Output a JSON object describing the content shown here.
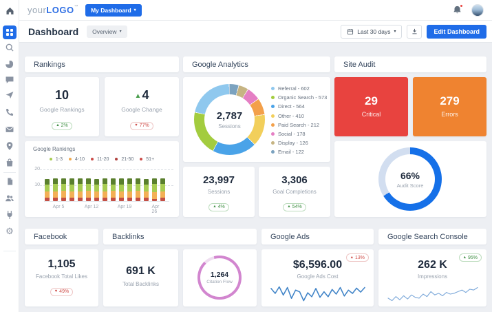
{
  "colors": {
    "accent_blue": "#1f6ce8",
    "critical_red": "#e8433f",
    "errors_orange": "#ef8330",
    "gauge_blue": "#1570e8",
    "gauge_track": "#d2def0",
    "citation_pink": "#d286cf",
    "citation_track": "#efddf0",
    "badge_green": "#3f8f43",
    "badge_red": "#cf4a46"
  },
  "topbar": {
    "logo_prefix": "your",
    "logo_main": "LOGO",
    "logo_tm": "™",
    "menu_label": "My Dashboard",
    "menu_caret": "▾"
  },
  "page_header": {
    "title": "Dashboard",
    "view_label": "Overview",
    "view_caret": "▾",
    "date_label": "Last 30 days",
    "date_caret": "▾",
    "edit_label": "Edit Dashboard"
  },
  "sidebar": {
    "icons": [
      "home",
      "dashboard",
      "search",
      "pie-chart",
      "chat",
      "send",
      "phone",
      "mail",
      "location",
      "shopping-bag",
      "document",
      "users",
      "plug",
      "settings"
    ]
  },
  "rankings": {
    "title": "Rankings",
    "stats": [
      {
        "value": "10",
        "label": "Google Rankings",
        "badge": {
          "dir": "up",
          "text": "2%",
          "tone": "green"
        }
      },
      {
        "arrow": "▲",
        "value": "4",
        "label": "Google Change",
        "badge": {
          "dir": "down",
          "text": "77%",
          "tone": "red"
        }
      }
    ],
    "chart_title": "Google Rankings",
    "yticks": [
      "20",
      "10"
    ]
  },
  "analytics": {
    "title": "Google Analytics",
    "stats": [
      {
        "value": "23,997",
        "label": "Sessions",
        "badge": {
          "dir": "up",
          "text": "4%",
          "tone": "green"
        }
      },
      {
        "value": "3,306",
        "label": "Goal Completions",
        "badge": {
          "dir": "up",
          "text": "54%",
          "tone": "green"
        }
      }
    ]
  },
  "site_audit": {
    "title": "Site Audit",
    "tiles": [
      {
        "value": "29",
        "label": "Critical"
      },
      {
        "value": "279",
        "label": "Errors"
      }
    ],
    "gauge_value": "66%",
    "gauge_label": "Audit Score"
  },
  "facebook": {
    "title": "Facebook",
    "stat": {
      "value": "1,105",
      "label": "Facebook Total Likes",
      "badge": {
        "dir": "down",
        "text": "49%",
        "tone": "red"
      }
    }
  },
  "backlinks": {
    "title": "Backlinks",
    "stat": {
      "value": "691 K",
      "label": "Total Backlinks"
    },
    "citation": {
      "value": "1,264",
      "label": "Citation Flow"
    }
  },
  "google_ads": {
    "title": "Google Ads",
    "stat": {
      "value": "$6,596.00",
      "label": "Google Ads Cost",
      "badge": {
        "dir": "up",
        "text": "13%",
        "tone": "red"
      }
    }
  },
  "search_console": {
    "title": "Google Search Console",
    "stat": {
      "value": "262 K",
      "label": "Impressions",
      "badge": {
        "dir": "up",
        "text": "95%",
        "tone": "green"
      }
    }
  },
  "chart_data": [
    {
      "type": "donut",
      "title": "Google Analytics Sessions",
      "total": "2,787",
      "center_label": "Sessions",
      "segments": [
        {
          "label": "Referral",
          "value": 602,
          "color": "#8fc8ee"
        },
        {
          "label": "Organic Search",
          "value": 573,
          "color": "#a3cc3f"
        },
        {
          "label": "Direct",
          "value": 564,
          "color": "#4aa3e8"
        },
        {
          "label": "Other",
          "value": 410,
          "color": "#f2cf5b"
        },
        {
          "label": "Paid Search",
          "value": 212,
          "color": "#f3a04a"
        },
        {
          "label": "Social",
          "value": 178,
          "color": "#e57fc4"
        },
        {
          "label": "Display",
          "value": 126,
          "color": "#c6b483"
        },
        {
          "label": "Email",
          "value": 122,
          "color": "#7ba2bf"
        }
      ]
    },
    {
      "type": "bar",
      "stacked": true,
      "title": "Google Rankings",
      "categories": [
        "Apr 5",
        "Apr 12",
        "Apr 19",
        "Apr 26"
      ],
      "ylim": [
        0,
        22
      ],
      "y_ticks": [
        10,
        20
      ],
      "legend": [
        {
          "label": "1-3",
          "color": "#a8cc52"
        },
        {
          "label": "4-10",
          "color": "#f0a94e"
        },
        {
          "label": "11-20",
          "color": "#cb4b47"
        },
        {
          "label": "21-50",
          "color": "#b0413e"
        },
        {
          "label": "51+",
          "color": "#cb4b47"
        }
      ],
      "series": [
        {
          "name": "red",
          "color": "#c34f45",
          "values": [
            2,
            2,
            2,
            2,
            2,
            2,
            2,
            2,
            2,
            2,
            2,
            2,
            2,
            1.5,
            2
          ]
        },
        {
          "name": "orange",
          "color": "#f3b056",
          "values": [
            4,
            4,
            4.5,
            4,
            4,
            4.5,
            4,
            4,
            4.5,
            4,
            4,
            4.5,
            4,
            4,
            4
          ]
        },
        {
          "name": "light-green",
          "color": "#a8cc52",
          "values": [
            4,
            4.5,
            4,
            4,
            4.5,
            4,
            4,
            4.5,
            3.5,
            4,
            4.5,
            4,
            4,
            5,
            4.5
          ]
        },
        {
          "name": "dark-green",
          "color": "#5a7f2d",
          "values": [
            3.5,
            3.5,
            3.5,
            4,
            3.5,
            3.5,
            3.5,
            3.5,
            4,
            4,
            3.5,
            3.5,
            3.5,
            3.5,
            3.5
          ]
        }
      ]
    },
    {
      "type": "gauge",
      "value": 66,
      "label": "Audit Score",
      "color": "#1570e8",
      "track": "#d2def0"
    },
    {
      "type": "ring",
      "value": 1264,
      "label": "Citation Flow",
      "percent": 92,
      "color": "#d286cf",
      "track": "#efddf0"
    },
    {
      "type": "line",
      "name": "Google Ads Cost",
      "color": "#4285c8",
      "values": [
        55,
        40,
        60,
        35,
        58,
        25,
        50,
        45,
        18,
        42,
        30,
        55,
        28,
        45,
        30,
        52,
        38,
        58,
        32,
        50,
        40,
        56,
        44,
        58
      ]
    },
    {
      "type": "line",
      "name": "Impressions",
      "color": "#7aa7d9",
      "values": [
        22,
        16,
        26,
        18,
        28,
        20,
        30,
        24,
        22,
        32,
        26,
        38,
        30,
        34,
        28,
        36,
        32,
        34,
        38,
        42,
        36,
        44,
        42,
        48
      ]
    }
  ]
}
